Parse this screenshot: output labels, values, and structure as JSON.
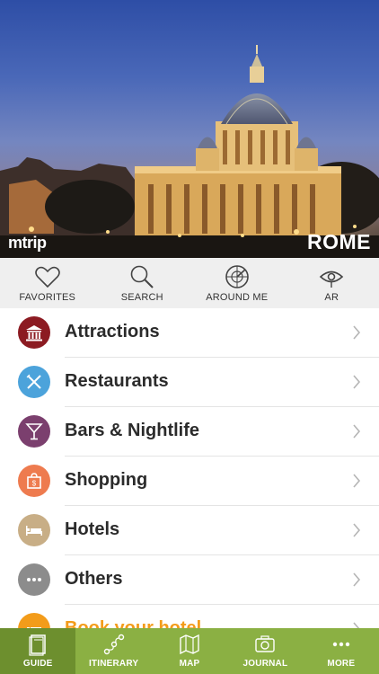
{
  "hero": {
    "brand": "mtrip",
    "city": "ROME"
  },
  "quickbar": {
    "items": [
      {
        "label": "FAVORITES",
        "icon": "heart-icon"
      },
      {
        "label": "SEARCH",
        "icon": "magnifier-icon"
      },
      {
        "label": "AROUND ME",
        "icon": "radar-icon"
      },
      {
        "label": "AR",
        "icon": "eye-icon"
      }
    ]
  },
  "list": {
    "items": [
      {
        "label": "Attractions",
        "icon": "museum-icon",
        "color": "#8c1b22"
      },
      {
        "label": "Restaurants",
        "icon": "fork-knife-icon",
        "color": "#4ca3db"
      },
      {
        "label": "Bars & Nightlife",
        "icon": "cocktail-icon",
        "color": "#7b3f6e"
      },
      {
        "label": "Shopping",
        "icon": "shopping-bag-icon",
        "color": "#ee7b4f"
      },
      {
        "label": "Hotels",
        "icon": "bed-icon",
        "color": "#c8ae86"
      },
      {
        "label": "Others",
        "icon": "more-dots-icon",
        "color": "#8c8c8c"
      },
      {
        "label": "Book your hotel",
        "icon": "bed-icon",
        "color": "#f39c1a"
      }
    ]
  },
  "tabbar": {
    "items": [
      {
        "label": "GUIDE",
        "icon": "book-icon",
        "active": true
      },
      {
        "label": "ITINERARY",
        "icon": "route-icon",
        "active": false
      },
      {
        "label": "MAP",
        "icon": "map-icon",
        "active": false
      },
      {
        "label": "JOURNAL",
        "icon": "camera-icon",
        "active": false
      },
      {
        "label": "MORE",
        "icon": "more-dots-icon",
        "active": false
      }
    ]
  },
  "colors": {
    "tab_bar": "#8bb043",
    "tab_active": "#6d8f2e",
    "booking_accent": "#f39c1a"
  }
}
